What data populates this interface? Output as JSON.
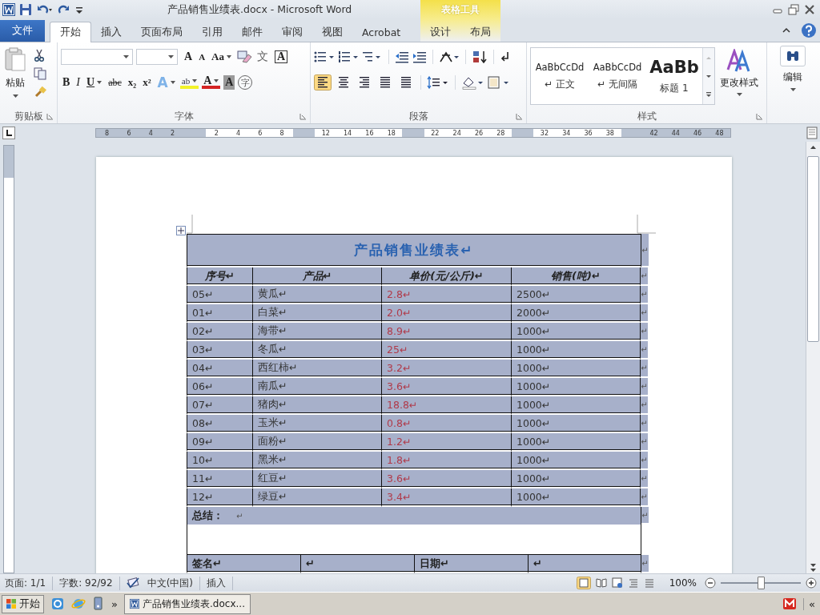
{
  "window": {
    "title": "产品销售业绩表.docx - Microsoft Word",
    "context_group": "表格工具"
  },
  "tabs": [
    {
      "label": "文件",
      "kind": "file",
      "selected": false
    },
    {
      "label": "开始",
      "kind": "main",
      "selected": true
    },
    {
      "label": "插入",
      "kind": "main",
      "selected": false
    },
    {
      "label": "页面布局",
      "kind": "main",
      "selected": false
    },
    {
      "label": "引用",
      "kind": "main",
      "selected": false
    },
    {
      "label": "邮件",
      "kind": "main",
      "selected": false
    },
    {
      "label": "审阅",
      "kind": "main",
      "selected": false
    },
    {
      "label": "视图",
      "kind": "main",
      "selected": false
    },
    {
      "label": "Acrobat",
      "kind": "main",
      "selected": false
    },
    {
      "label": "设计",
      "kind": "context",
      "selected": false
    },
    {
      "label": "布局",
      "kind": "context",
      "selected": false
    }
  ],
  "ribbon": {
    "clipboard": {
      "paste": "粘贴",
      "label": "剪贴板"
    },
    "font": {
      "label": "字体",
      "row1": [
        {
          "kind": "grow",
          "text": "A"
        },
        {
          "kind": "shrink",
          "text": "A"
        },
        {
          "kind": "case",
          "text": "Aa"
        },
        {
          "kind": "clear"
        },
        {
          "kind": "phonetic",
          "text": "文"
        },
        {
          "kind": "border",
          "text": "A"
        }
      ],
      "row2": [
        {
          "kind": "bold",
          "text": "B"
        },
        {
          "kind": "italic",
          "text": "I"
        },
        {
          "kind": "underline",
          "text": "U"
        },
        {
          "kind": "strike",
          "text": "abc"
        },
        {
          "kind": "sub",
          "text": "x₂"
        },
        {
          "kind": "sup",
          "text": "x²"
        },
        {
          "kind": "effect",
          "text": "A"
        },
        {
          "kind": "highlight",
          "text": "ab"
        },
        {
          "kind": "color",
          "text": "A"
        },
        {
          "kind": "shade",
          "text": "A"
        },
        {
          "kind": "enclose",
          "text": "字"
        }
      ]
    },
    "paragraph": {
      "label": "段落",
      "alignments": [
        {
          "kind": "left",
          "selected": true
        },
        {
          "kind": "center",
          "selected": false
        },
        {
          "kind": "right",
          "selected": false
        },
        {
          "kind": "justify",
          "selected": false
        },
        {
          "kind": "distribute",
          "selected": false
        }
      ]
    },
    "styles": {
      "label": "样式",
      "items": [
        {
          "preview": "AaBbCcDd",
          "name": "↵ 正文",
          "kind": "normal"
        },
        {
          "preview": "AaBbCcDd",
          "name": "↵ 无间隔",
          "kind": "normal"
        },
        {
          "preview": "AaBb",
          "name": "标题 1",
          "kind": "heading"
        }
      ],
      "change": "更改样式"
    },
    "editing": {
      "label": "编辑"
    }
  },
  "ruler": [
    [
      "8",
      "6",
      "4",
      "2"
    ],
    [
      "2",
      "4",
      "6",
      "8"
    ],
    [
      "12",
      "14",
      "16",
      "18"
    ],
    [
      "22",
      "24",
      "26",
      "28"
    ],
    [
      "32",
      "34",
      "36",
      "38"
    ],
    [
      "42",
      "44",
      "46",
      "48"
    ]
  ],
  "table": {
    "title": "产品销售业绩表↵",
    "end": "↵",
    "columns": [
      "序号↵",
      "产品↵",
      "单价(元/公斤)↵",
      "销售(吨)↵"
    ],
    "rows": [
      {
        "cells": [
          "05↵",
          "黄瓜↵",
          "2.8↵",
          "2500↵"
        ],
        "end": "↵"
      },
      {
        "cells": [
          "01↵",
          "白菜↵",
          "2.0↵",
          "2000↵"
        ],
        "end": "↵"
      },
      {
        "cells": [
          "02↵",
          "海带↵",
          "8.9↵",
          "1000↵"
        ],
        "end": "↵"
      },
      {
        "cells": [
          "03↵",
          "冬瓜↵",
          "25↵",
          "1000↵"
        ],
        "end": "↵"
      },
      {
        "cells": [
          "04↵",
          "西红柿↵",
          "3.2↵",
          "1000↵"
        ],
        "end": "↵"
      },
      {
        "cells": [
          "06↵",
          "南瓜↵",
          "3.6↵",
          "1000↵"
        ],
        "end": "↵"
      },
      {
        "cells": [
          "07↵",
          "猪肉↵",
          "18.8↵",
          "1000↵"
        ],
        "end": "↵"
      },
      {
        "cells": [
          "08↵",
          "玉米↵",
          "0.8↵",
          "1000↵"
        ],
        "end": "↵"
      },
      {
        "cells": [
          "09↵",
          "面粉↵",
          "1.2↵",
          "1000↵"
        ],
        "end": "↵"
      },
      {
        "cells": [
          "10↵",
          "黑米↵",
          "1.8↵",
          "1000↵"
        ],
        "end": "↵"
      },
      {
        "cells": [
          "11↵",
          "红豆↵",
          "3.6↵",
          "1000↵"
        ],
        "end": "↵"
      },
      {
        "cells": [
          "12↵",
          "绿豆↵",
          "3.4↵",
          "1000↵"
        ],
        "end": "↵"
      }
    ],
    "header_end": "↵",
    "summary": {
      "label": "总结：",
      "mark": "↵",
      "end": "↵"
    },
    "signature": {
      "cells": [
        "签名↵",
        "↵",
        "日期↵",
        "↵"
      ],
      "end": "↵"
    }
  },
  "status_bar": {
    "items": [
      "页面: 1/1",
      "字数: 92/92",
      "中文(中国)",
      "插入"
    ],
    "zoom": "100%",
    "zoom_level": {
      "level": 0.5
    }
  },
  "taskbar": {
    "start": "开始",
    "more": "»",
    "task": "产品销售业绩表.docx...",
    "tray": "«"
  }
}
